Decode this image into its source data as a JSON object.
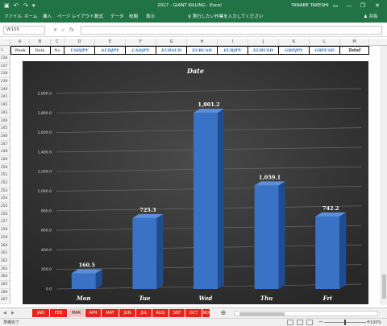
{
  "titlebar": {
    "title": "2017 - GIANT KILLING  -  Excel",
    "user": "TANABE TAKESHI",
    "save_glyph": "▣",
    "undo_glyph": "↶",
    "redo_glyph": "↷",
    "customize_glyph": "▾",
    "ribbon_display_glyph": "▭",
    "minimize_glyph": "—",
    "restore_glyph": "❐",
    "close_glyph": "✕"
  },
  "ribbon_tabs": [
    "ファイル",
    "ホーム",
    "挿入",
    "ページ レイアウト",
    "数式",
    "データ",
    "校閲",
    "表示"
  ],
  "tell_me": "♀ 実行したい作業を入力してください",
  "share": "♟ 共有",
  "formula_bar": {
    "name_box": "W155",
    "cancel_glyph": "✕",
    "enter_glyph": "✓",
    "fx_glyph": "fx",
    "formula": ""
  },
  "columns": [
    "A",
    "B",
    "C",
    "D",
    "E",
    "F",
    "G",
    "H",
    "I",
    "J",
    "K",
    "L",
    "M"
  ],
  "header_row": {
    "row_number": "1",
    "cells": [
      "Week",
      "Date",
      "No",
      "USDJPY",
      "AUDJPY",
      "CADJPY",
      "EURAUD",
      "EURCAD",
      "EURJPY",
      "EURUSD",
      "GBPJPY",
      "GBPUSD",
      "Total"
    ]
  },
  "row_numbers": [
    "236",
    "237",
    "238",
    "239",
    "240",
    "241",
    "242",
    "243",
    "244",
    "245",
    "246",
    "247",
    "248",
    "249",
    "250",
    "251",
    "252",
    "253",
    "254",
    "255",
    "256",
    "257",
    "258",
    "259",
    "260",
    "261",
    "262",
    "263",
    "264",
    "265",
    "266",
    "267"
  ],
  "chart_data": {
    "type": "bar",
    "title": "Date",
    "categories": [
      "Mon",
      "Tue",
      "Wed",
      "Thu",
      "Fri"
    ],
    "values": [
      160.5,
      725.3,
      1801.2,
      1059.1,
      742.2
    ],
    "value_labels": [
      "160.5",
      "725.3",
      "1,801.2",
      "1,059.1",
      "742.2"
    ],
    "ylim": [
      0,
      2000
    ],
    "yticks": [
      "0.0",
      "200.0",
      "400.0",
      "600.0",
      "800.0",
      "1,000.0",
      "1,200.0",
      "1,400.0",
      "1,600.0",
      "1,800.0",
      "2,000.0"
    ],
    "grid": true,
    "legend": "none",
    "colors": {
      "bar": "#3a72c6",
      "bar_top": "#5b8fd8",
      "bar_side": "#1f4c8f",
      "background": "#3b3b3b",
      "grid": "#6a6a6a",
      "text": "#ffffff"
    }
  },
  "sheet_tabs": [
    "JAN",
    "FEB",
    "MAR",
    "APR",
    "MAY",
    "JUN",
    "JUL",
    "AUG",
    "SEP",
    "OCT",
    "NO"
  ],
  "active_sheet": "MAR",
  "sheet_nav": {
    "prev_glyph": "◀",
    "next_glyph": "▶",
    "add_glyph": "⊕"
  },
  "status": {
    "ready": "準備完了",
    "zoom": "100%",
    "zoom_minus": "−",
    "zoom_plus": "+"
  },
  "colors": {
    "excel_green": "#217346",
    "sheet_tab_red": "#e8231d",
    "currency_blue": "#2e6fbf"
  }
}
